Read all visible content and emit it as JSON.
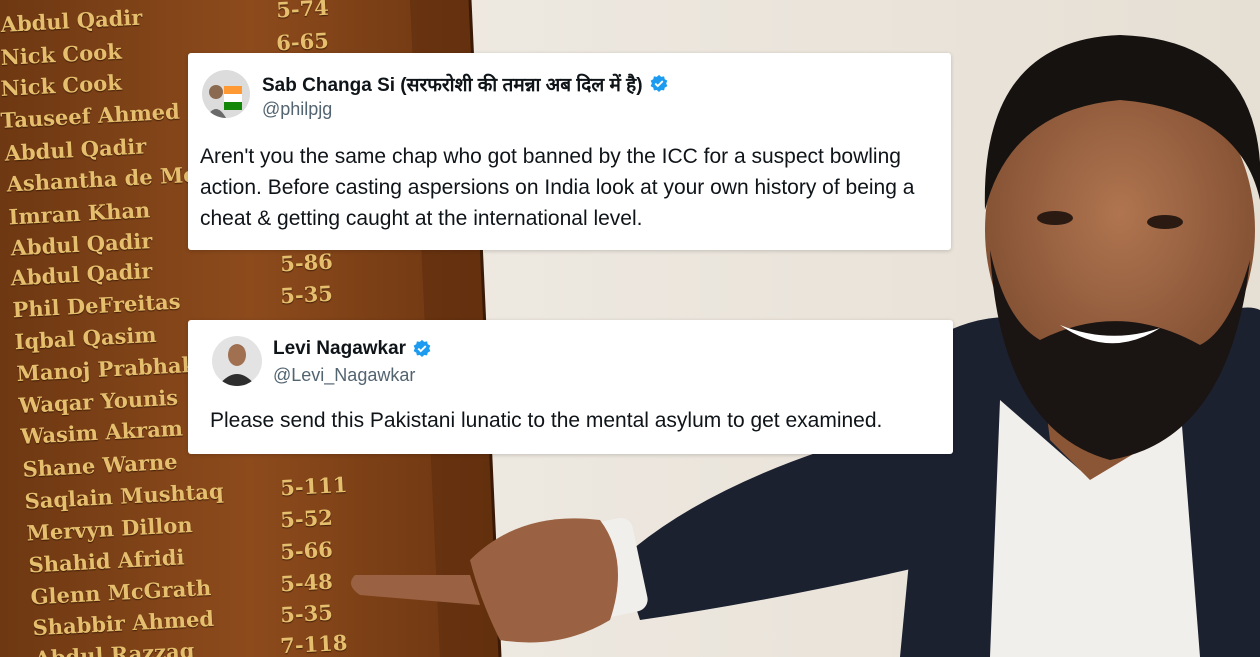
{
  "board": {
    "rows": [
      {
        "name": "Abdul Qadir",
        "figure": "5-74"
      },
      {
        "name": "Nick Cook",
        "figure": "6-65"
      },
      {
        "name": "Nick Cook",
        "figure": ""
      },
      {
        "name": "Tauseef Ahmed",
        "figure": ""
      },
      {
        "name": "Abdul Qadir",
        "figure": ""
      },
      {
        "name": "Ashantha de Mel",
        "figure": ""
      },
      {
        "name": "Imran Khan",
        "figure": ""
      },
      {
        "name": "Abdul Qadir",
        "figure": ""
      },
      {
        "name": "Abdul Qadir",
        "figure": "5-86"
      },
      {
        "name": "Phil DeFreitas",
        "figure": "5-35"
      },
      {
        "name": "Iqbal Qasim",
        "figure": ""
      },
      {
        "name": "Manoj Prabhaka",
        "figure": ""
      },
      {
        "name": "Waqar Younis",
        "figure": ""
      },
      {
        "name": "Wasim Akram",
        "figure": ""
      },
      {
        "name": "Shane Warne",
        "figure": ""
      },
      {
        "name": "Saqlain Mushtaq",
        "figure": "5-111"
      },
      {
        "name": "Mervyn Dillon",
        "figure": "5-52"
      },
      {
        "name": "Shahid Afridi",
        "figure": "5-66"
      },
      {
        "name": "Glenn McGrath",
        "figure": "5-48"
      },
      {
        "name": "Shabbir Ahmed",
        "figure": "5-35"
      },
      {
        "name": "Abdul Razzaq",
        "figure": "7-118"
      }
    ]
  },
  "tweets": [
    {
      "name": "Sab Changa Si (सरफरोशी की तमन्ना अब दिल में है)",
      "handle": "@philpjg",
      "text": "Aren't you the same chap who got banned by the ICC for a suspect bowling action. Before casting aspersions on India look at your own history of being a cheat & getting caught at the international level.",
      "verified": true
    },
    {
      "name": "Levi Nagawkar",
      "handle": "@Levi_Nagawkar",
      "text": "Please send this Pakistani lunatic to the mental asylum to get examined.",
      "verified": true
    }
  ],
  "colors": {
    "board_wood": "#8a4a1a",
    "board_text": "#e6bf6e",
    "wall": "#efe9e0",
    "verified_blue": "#1d9bf0",
    "handle_grey": "#536471",
    "jacket": "#1c2130",
    "shirt": "#f1efec",
    "skin": "#9a6242"
  },
  "icons": {
    "verified": "verified-badge-icon"
  }
}
